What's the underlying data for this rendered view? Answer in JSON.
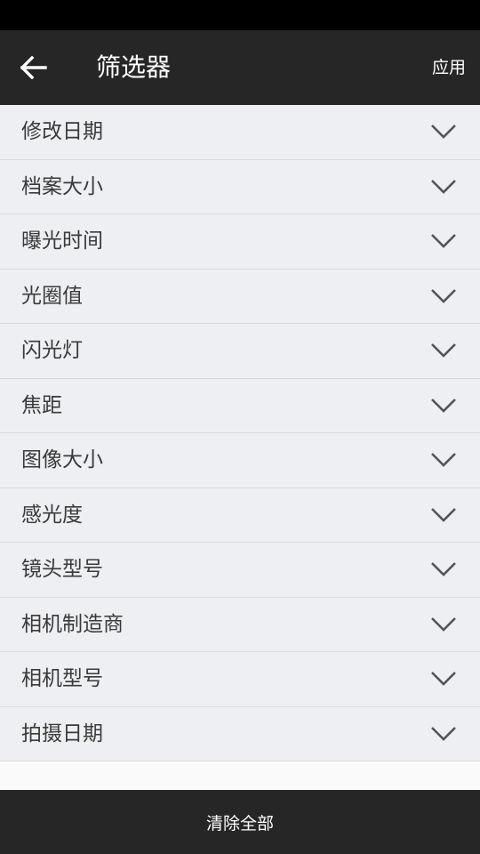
{
  "colors": {
    "status_bar": "#000000",
    "app_bar": "#262626",
    "row_background": "#eeeff2",
    "row_divider": "#d9d9dc",
    "text_primary": "#3a3a3a",
    "text_on_dark": "#ffffff",
    "chevron": "#555555"
  },
  "app_bar": {
    "back_icon": "arrow-left-icon",
    "title": "筛选器",
    "apply_label": "应用"
  },
  "filters": {
    "chevron_icon": "chevron-down-icon",
    "items": [
      {
        "label": "修改日期"
      },
      {
        "label": "档案大小"
      },
      {
        "label": "曝光时间"
      },
      {
        "label": "光圈值"
      },
      {
        "label": "闪光灯"
      },
      {
        "label": "焦距"
      },
      {
        "label": "图像大小"
      },
      {
        "label": "感光度"
      },
      {
        "label": "镜头型号"
      },
      {
        "label": "相机制造商"
      },
      {
        "label": "相机型号"
      },
      {
        "label": "拍摄日期"
      }
    ]
  },
  "bottom_bar": {
    "clear_label": "清除全部"
  }
}
